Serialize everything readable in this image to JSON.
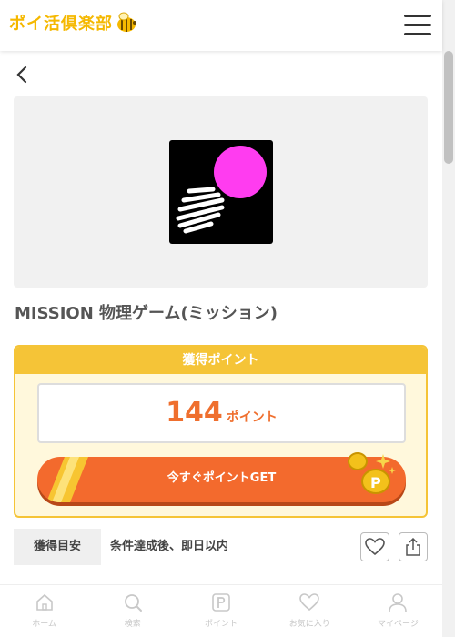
{
  "header": {
    "logo_text": "ポイ活倶楽部",
    "logo_icon": "bee-icon",
    "menu_icon": "hamburger-menu-icon"
  },
  "navigation": {
    "back_icon": "chevron-left-icon"
  },
  "app": {
    "title": "MISSION 物理ゲーム(ミッション)",
    "icon": "app-icon-pink-circle-white-scribble"
  },
  "point_card": {
    "header": "獲得ポイント",
    "points": "144",
    "unit": "ポイント",
    "cta_label": "今すぐポイントGET",
    "coins_icon": "coins-icon"
  },
  "info": {
    "label": "獲得目安",
    "value": "条件達成後、即日以内",
    "favorite_icon": "heart-icon",
    "share_icon": "share-icon"
  },
  "bottom_nav": {
    "items": [
      {
        "label": "ホーム",
        "icon": "home-icon"
      },
      {
        "label": "検索",
        "icon": "search-icon"
      },
      {
        "label": "ポイント",
        "icon": "point-icon"
      },
      {
        "label": "お気に入り",
        "icon": "heart-icon"
      },
      {
        "label": "マイページ",
        "icon": "user-icon"
      }
    ]
  },
  "colors": {
    "brand_yellow": "#f5b800",
    "card_yellow": "#f5c437",
    "accent_orange": "#f36a2d",
    "point_orange": "#ef6f2e",
    "app_icon_pink": "#ff3cf0"
  }
}
